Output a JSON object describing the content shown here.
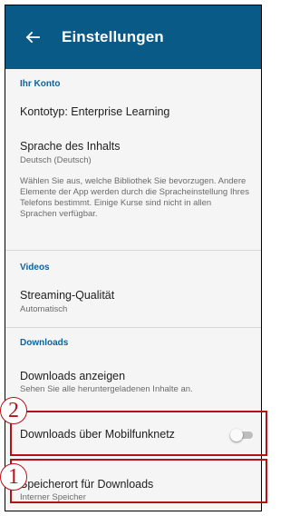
{
  "colors": {
    "appbar": "#0a5a87",
    "section_heading": "#0a64a0",
    "highlight": "#b31217"
  },
  "appbar": {
    "back_icon": "arrow-left-icon",
    "title": "Einstellungen"
  },
  "account": {
    "heading": "Ihr Konto",
    "account_type": "Kontotyp: Enterprise Learning",
    "content_language_label": "Sprache des Inhalts",
    "content_language_value": "Deutsch (Deutsch)",
    "content_language_help": "Wählen Sie aus, welche Bibliothek Sie bevorzugen. Andere Elemente der App werden durch die Spracheinstellung Ihres Telefons bestimmt. Einige Kurse sind nicht in allen Sprachen verfügbar."
  },
  "videos": {
    "heading": "Videos",
    "streaming_label": "Streaming-Qualität",
    "streaming_value": "Automatisch"
  },
  "downloads": {
    "heading": "Downloads",
    "show_label": "Downloads anzeigen",
    "show_sub": "Sehen Sie alle heruntergeladenen Inhalte an.",
    "mobile_label": "Downloads über Mobilfunknetz",
    "mobile_enabled": false,
    "location_label": "Speicherort für Downloads",
    "location_value": "Interner Speicher"
  },
  "annotations": {
    "marker_1": "1",
    "marker_2": "2"
  }
}
